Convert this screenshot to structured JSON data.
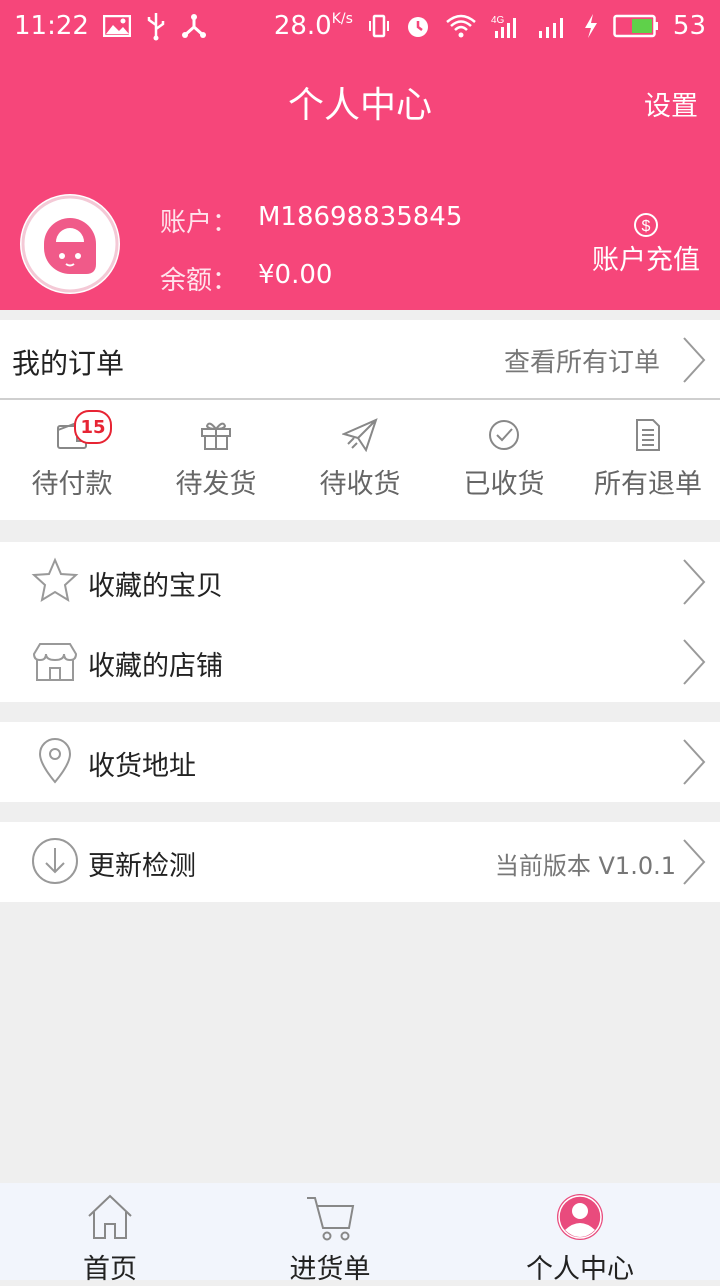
{
  "statusbar": {
    "time": "11:22",
    "speed": "28.0",
    "speed_unit": "K/s",
    "battery": "53"
  },
  "header": {
    "title": "个人中心",
    "settings": "设置",
    "account_label": "账户：",
    "account_value": "M18698835845",
    "balance_label": "余额：",
    "balance_value": "¥0.00",
    "recharge_label": "账户充值"
  },
  "orders": {
    "title": "我的订单",
    "view_all": "查看所有订单",
    "items": [
      {
        "label": "待付款",
        "icon": "wallet-icon",
        "badge": "15"
      },
      {
        "label": "待发货",
        "icon": "gift-icon"
      },
      {
        "label": "待收货",
        "icon": "paper-plane-icon"
      },
      {
        "label": "已收货",
        "icon": "check-circle-icon"
      },
      {
        "label": "所有退单",
        "icon": "document-icon"
      }
    ]
  },
  "favorites": {
    "items": [
      {
        "label": "收藏的宝贝",
        "icon": "star-icon"
      },
      {
        "label": "收藏的店铺",
        "icon": "store-icon"
      }
    ]
  },
  "address": {
    "label": "收货地址",
    "icon": "location-pin-icon"
  },
  "update": {
    "label": "更新检测",
    "version": "当前版本 V1.0.1",
    "icon": "download-circle-icon"
  },
  "tabbar": {
    "items": [
      {
        "label": "首页",
        "icon": "home-icon"
      },
      {
        "label": "进货单",
        "icon": "cart-icon"
      },
      {
        "label": "个人中心",
        "icon": "user-icon"
      }
    ]
  },
  "colors": {
    "accent": "#f6467a",
    "badge": "#e72433",
    "background": "#efefef",
    "tabbar": "#f2f5fc"
  }
}
